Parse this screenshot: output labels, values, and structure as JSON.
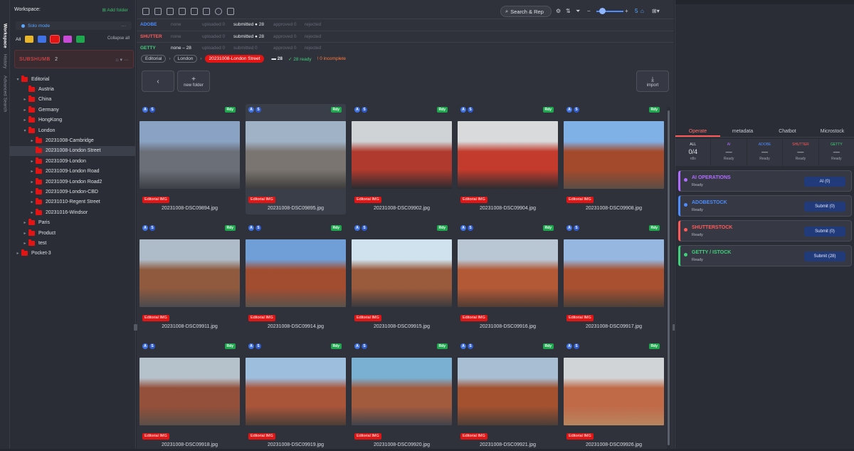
{
  "vtabs": [
    "Workspace",
    "History",
    "Advanced Search"
  ],
  "workspace": {
    "title": "Workspace:",
    "add_folder": "Add folder",
    "mode": "Solo mode",
    "chip_all": "All",
    "collapse_all": "Collapse all",
    "warning": "SUBSHUMB",
    "warning_count": "2",
    "tree": [
      {
        "label": "Editorial",
        "level": 1,
        "caret": "▾"
      },
      {
        "label": "Austria",
        "level": 2,
        "caret": ""
      },
      {
        "label": "China",
        "level": 2,
        "caret": "▸"
      },
      {
        "label": "Germany",
        "level": 2,
        "caret": "▸"
      },
      {
        "label": "HongKong",
        "level": 2,
        "caret": "▸"
      },
      {
        "label": "London",
        "level": 2,
        "caret": "▾"
      },
      {
        "label": "20231008-Cambridge",
        "level": 3,
        "caret": "▸"
      },
      {
        "label": "20231008-London Street",
        "level": 3,
        "caret": "",
        "selected": true
      },
      {
        "label": "20231009-London",
        "level": 3,
        "caret": "▸"
      },
      {
        "label": "20231009-London Road",
        "level": 3,
        "caret": "▸"
      },
      {
        "label": "20231009-London Road2",
        "level": 3,
        "caret": "▸"
      },
      {
        "label": "20231009-London-CBD",
        "level": 3,
        "caret": "▸"
      },
      {
        "label": "20231010-Regent Street",
        "level": 3,
        "caret": "▸"
      },
      {
        "label": "20231016-Windsor",
        "level": 3,
        "caret": "▸"
      },
      {
        "label": "Paris",
        "level": 2,
        "caret": "▸"
      },
      {
        "label": "Product",
        "level": 2,
        "caret": "▸"
      },
      {
        "label": "test",
        "level": 2,
        "caret": "▸"
      },
      {
        "label": "Pocket-3",
        "level": 1,
        "caret": "▸"
      }
    ]
  },
  "toolbar": {
    "search_label": "Search & Rep",
    "count": "5"
  },
  "agencies": [
    {
      "name": "ADOBE",
      "color": "#4d8dff",
      "cells": [
        "none",
        "uploaded 0",
        "submitted ● 28",
        "approved 0",
        "rejected"
      ]
    },
    {
      "name": "SHUTTER",
      "color": "#ff5a5a",
      "cells": [
        "none",
        "uploaded 0",
        "submitted ● 28",
        "approved 0",
        "rejected"
      ]
    },
    {
      "name": "GETTY",
      "color": "#3fd17a",
      "cells": [
        "none – 28",
        "uploaded 0",
        "submitted 0",
        "approved 0",
        "rejected"
      ]
    }
  ],
  "crumbs": [
    "Editorial",
    "London",
    "20231008-London Street"
  ],
  "crumb_stats": {
    "total": "28",
    "ready": "✓ 28 ready",
    "incomplete": "! 0 incomplete"
  },
  "nav": {
    "new_folder": "new folder",
    "import": "import"
  },
  "cards": [
    {
      "name": "20231008-DSC09894.jpg",
      "tag": "Editorial IMG",
      "rdy": "Rdy"
    },
    {
      "name": "20231008-DSC09895.jpg",
      "tag": "Editorial IMG",
      "rdy": "Rdy",
      "selected": true
    },
    {
      "name": "20231008-DSC09902.jpg",
      "tag": "Editorial IMG",
      "rdy": "Rdy"
    },
    {
      "name": "20231008-DSC09904.jpg",
      "tag": "Editorial IMG",
      "rdy": "Rdy"
    },
    {
      "name": "20231008-DSC09908.jpg",
      "tag": "Editorial IMG",
      "rdy": "Rdy"
    },
    {
      "name": "20231008-DSC09911.jpg",
      "tag": "Editorial IMG",
      "rdy": "Rdy"
    },
    {
      "name": "20231008-DSC09914.jpg",
      "tag": "Editorial IMG",
      "rdy": "Rdy"
    },
    {
      "name": "20231008-DSC09915.jpg",
      "tag": "Editorial IMG",
      "rdy": "Rdy"
    },
    {
      "name": "20231008-DSC09916.jpg",
      "tag": "Editorial IMG",
      "rdy": "Rdy"
    },
    {
      "name": "20231008-DSC09917.jpg",
      "tag": "Editorial IMG",
      "rdy": "Rdy"
    },
    {
      "name": "20231008-DSC09918.jpg",
      "tag": "Editorial IMG",
      "rdy": "Rdy"
    },
    {
      "name": "20231008-DSC09919.jpg",
      "tag": "Editorial IMG",
      "rdy": "Rdy"
    },
    {
      "name": "20231008-DSC09920.jpg",
      "tag": "Editorial IMG",
      "rdy": "Rdy"
    },
    {
      "name": "20231008-DSC09921.jpg",
      "tag": "Editorial IMG",
      "rdy": "Rdy"
    },
    {
      "name": "20231008-DSC09926.jpg",
      "tag": "Editorial IMG",
      "rdy": "Rdy"
    }
  ],
  "right": {
    "tabs": [
      "Operate",
      "metadata",
      "Chatbot",
      "Microstock"
    ],
    "counts": [
      {
        "label": "ALL",
        "value": "0/4",
        "sub": "rdls"
      },
      {
        "label": "AI",
        "value": "—",
        "sub": "Ready"
      },
      {
        "label": "ADOBE",
        "value": "—",
        "sub": "Ready"
      },
      {
        "label": "SHUTTER",
        "value": "—",
        "sub": "Ready"
      },
      {
        "label": "GETTY",
        "value": "—",
        "sub": "Ready"
      }
    ],
    "ops": [
      {
        "title": "AI OPERATIONS",
        "sub": "Ready",
        "btn": "AI (0)",
        "color": "#b06cff"
      },
      {
        "title": "ADOBESTOCK",
        "sub": "Ready",
        "btn": "Submit (0)",
        "color": "#4d8dff"
      },
      {
        "title": "SHUTTERSTOCK",
        "sub": "Ready",
        "btn": "Submit (0)",
        "color": "#ff5a5a"
      },
      {
        "title": "GETTY / ISTOCK",
        "sub": "Ready",
        "btn": "Submit (28)",
        "color": "#3fd17a"
      }
    ]
  }
}
